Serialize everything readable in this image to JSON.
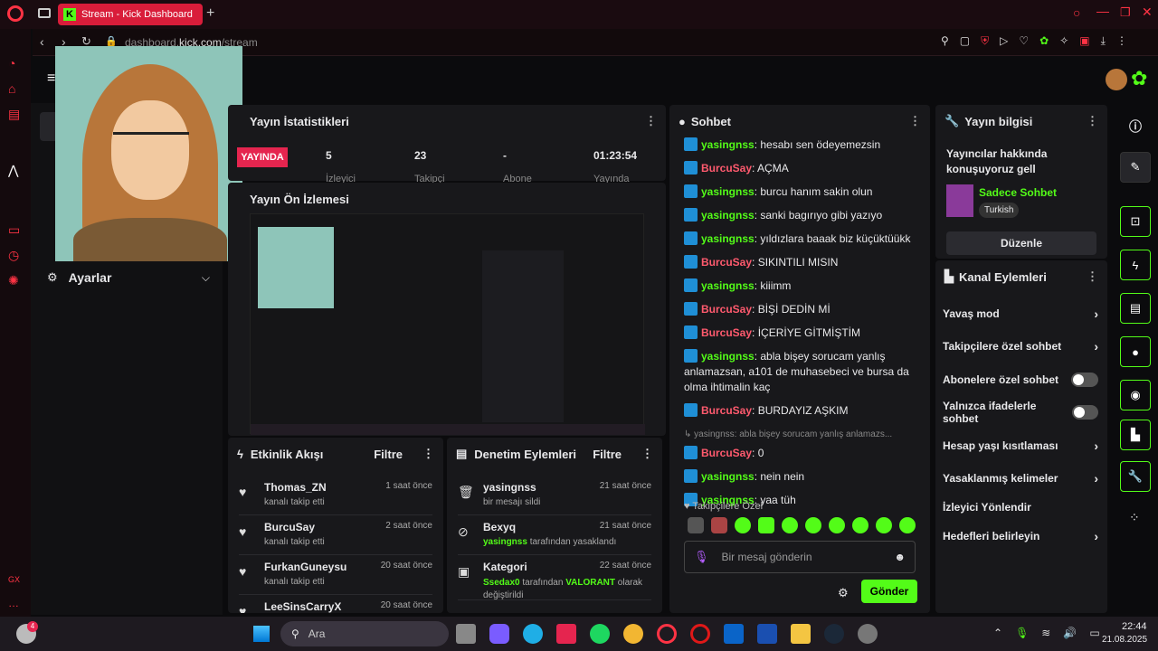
{
  "browser": {
    "tab_title": "Stream - Kick Dashboard",
    "url_gray": "dashboard.",
    "url_bright": "kick.com",
    "url_path": "/stream"
  },
  "sidebar": {
    "settings": "Ayarlar"
  },
  "stats": {
    "title": "Yayın İstatistikleri",
    "live": "YAYINDA",
    "viewers": "5",
    "viewers_label": "İzleyici",
    "followers": "23",
    "followers_label": "Takipçi",
    "subs": "-",
    "subs_label": "Abone",
    "uptime": "01:23:54",
    "uptime_label": "Yayında"
  },
  "preview": {
    "title": "Yayın Ön İzlemesi"
  },
  "activity": {
    "title": "Etkinlik Akışı",
    "filter": "Filtre",
    "items": [
      {
        "name": "Thomas_ZN",
        "sub": "kanalı takip etti",
        "time": "1 saat önce"
      },
      {
        "name": "BurcuSay",
        "sub": "kanalı takip etti",
        "time": "2 saat önce"
      },
      {
        "name": "FurkanGuneysu",
        "sub": "kanalı takip etti",
        "time": "20 saat önce"
      },
      {
        "name": "LeeSinsCarryX",
        "sub": "",
        "time": "20 saat önce"
      }
    ]
  },
  "moderation": {
    "title": "Denetim Eylemleri",
    "filter": "Filtre",
    "items": [
      {
        "name": "yasingnss",
        "sub": "bir mesajı sildi",
        "time": "21 saat önce"
      },
      {
        "name": "Bexyq",
        "sub_user": "yasingnss",
        "sub": "tarafından yasaklandı",
        "time": "21 saat önce"
      },
      {
        "name": "Kategori",
        "sub_user": "Ssedax0",
        "sub": "tarafından",
        "sub_cat": "VALORANT",
        "sub_end": "olarak değiştirildi",
        "time": "22 saat önce"
      }
    ]
  },
  "chat": {
    "title": "Sohbet",
    "messages": [
      {
        "user": "yasingnss",
        "text": "hesabı sen ödeyemezsin"
      },
      {
        "user": "BurcuSay",
        "text": "AÇMA"
      },
      {
        "user": "yasingnss",
        "text": "burcu hanım sakin olun"
      },
      {
        "user": "yasingnss",
        "text": "sanki bagırıyo gibi yazıyo"
      },
      {
        "user": "yasingnss",
        "text": "yıldızlara baaak biz küçüktüükk"
      },
      {
        "user": "BurcuSay",
        "text": "SIKINTILI MISIN"
      },
      {
        "user": "yasingnss",
        "text": "kiiimm"
      },
      {
        "user": "BurcuSay",
        "text": "BİŞİ DEDİN Mİ"
      },
      {
        "user": "BurcuSay",
        "text": "İÇERİYE GİTMİŞTİM"
      },
      {
        "user": "yasingnss",
        "text": "abla bişey sorucam yanlış anlamazsan, a101 de muhasebeci ve bursa da olma ihtimalin kaç"
      },
      {
        "user": "BurcuSay",
        "text": "BURDAYIZ AŞKIM"
      },
      {
        "user": "BurcuSay",
        "text": "0"
      },
      {
        "user": "yasingnss",
        "text": "nein nein"
      },
      {
        "user": "yasingnss",
        "text": "yaa tüh"
      }
    ],
    "reply": "yasingnss: abla bişey sorucam yanlış anlamazs...",
    "follower_label": "Takipçilere Özel",
    "placeholder": "Bir mesaj gönderin",
    "send": "Gönder"
  },
  "info": {
    "title": "Yayın bilgisi",
    "stream_title": "Yayıncılar hakkında konuşuyoruz gell",
    "category": "Sadece Sohbet",
    "language": "Turkish",
    "edit": "Düzenle"
  },
  "channel": {
    "title": "Kanal Eylemleri",
    "items": [
      "Yavaş mod",
      "Takipçilere özel sohbet",
      "Abonelere özel sohbet",
      "Yalnızca ifadelerle sohbet",
      "Hesap yaşı kısıtlaması",
      "Yasaklanmış kelimeler",
      "İzleyici Yönlendir",
      "Hedefleri belirleyin"
    ]
  },
  "taskbar": {
    "search": "Ara",
    "time": "22:44",
    "date": "21.08.2025",
    "badge": "4"
  },
  "colors": {
    "accent": "#53fc18",
    "live": "#e5254f",
    "browser": "#ff3344"
  }
}
